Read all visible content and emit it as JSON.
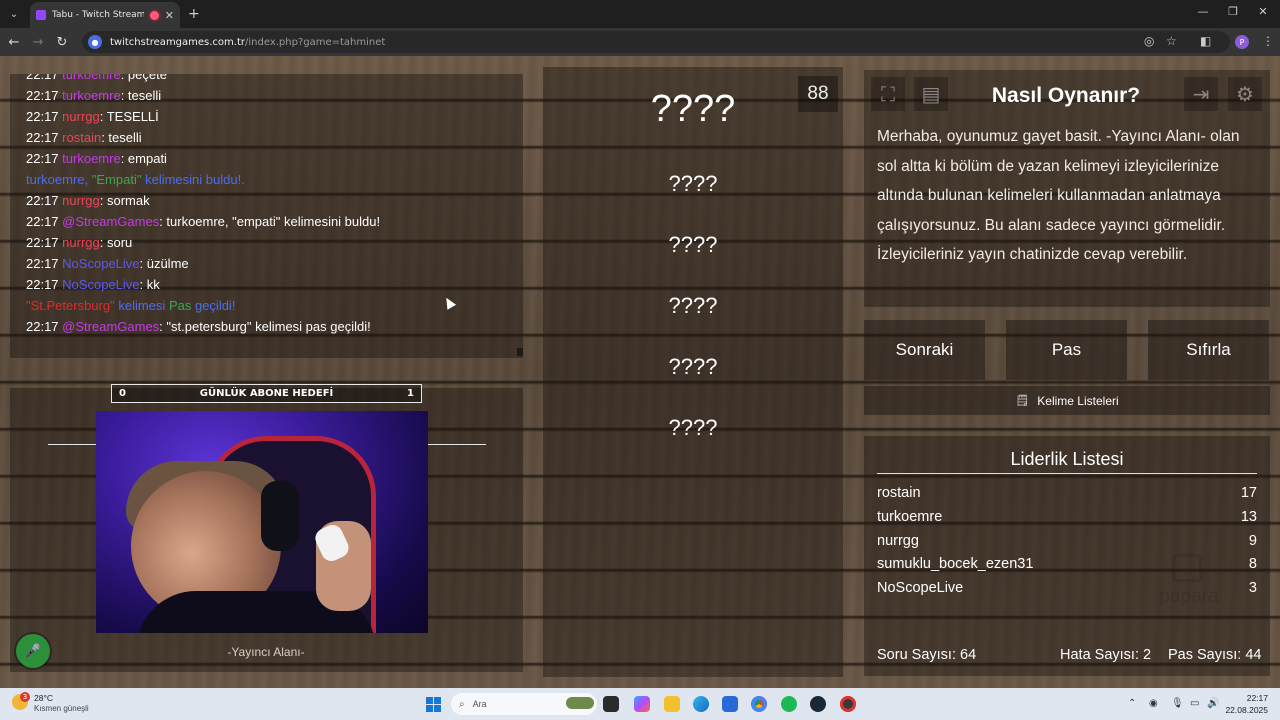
{
  "browser": {
    "tab_title": "Tabu - Twitch Stream Game",
    "url_host": "twitchstreamgames.com.tr",
    "url_path": "/index.php?game=tahminet",
    "profile_initial": "P"
  },
  "chat": {
    "lines": [
      {
        "time": "22:17",
        "user": "turkoemre",
        "text": ": peçete"
      },
      {
        "time": "22:17",
        "user": "turkoemre",
        "text": ": teselli"
      },
      {
        "time": "22:17",
        "user": "nurrgg",
        "text": ": TESELLİ"
      },
      {
        "time": "22:17",
        "user": "rostain",
        "text": ": teselli"
      },
      {
        "time": "22:17",
        "user": "turkoemre",
        "text": ": empati"
      },
      {
        "sys_user": "turkoemre,",
        "sys_word": "\"Empati\"",
        "sys_rest": "kelimesini buldu!."
      },
      {
        "time": "22:17",
        "user": "nurrgg",
        "text": ": sormak"
      },
      {
        "time": "22:17",
        "user": "@StreamGames",
        "text": ": turkoemre, \"empati\" kelimesini buldu!"
      },
      {
        "time": "22:17",
        "user": "nurrgg",
        "text": ": soru"
      },
      {
        "time": "22:17",
        "user": "NoScopeLive",
        "text": ": üzülme"
      },
      {
        "time": "22:17",
        "user": "NoScopeLive",
        "text": ": kk"
      },
      {
        "pass_word": "\"St.Petersburg\"",
        "pass_mid": "kelimesi",
        "pass_kw": "Pas",
        "pass_end": "geçildi!"
      },
      {
        "time": "22:17",
        "user": "@StreamGames",
        "text": ": \"st.petersburg\" kelimesi pas geçildi!"
      }
    ]
  },
  "streamer": {
    "goal_title": "GÜNLÜK ABONE HEDEFİ",
    "goal_current": "0",
    "goal_target": "1",
    "area_label": "-Yayıncı Alanı-",
    "mic_icon": "microphone-icon"
  },
  "words": {
    "timer": "88",
    "main": "????",
    "list": [
      "????",
      "????",
      "????",
      "????",
      "????"
    ]
  },
  "howto": {
    "title": "Nasıl Oynanır?",
    "text": "Merhaba, oyunumuz gayet basit. -Yayıncı Alanı- olan sol altta ki bölüm de yazan kelimeyi izleyicilerinize altında bulunan kelimeleri kullanmadan anlatmaya çalışıyorsunuz. Bu alanı sadece yayıncı görmelidir. İzleyicileriniz yayın chatinizde cevap verebilir."
  },
  "actions": {
    "next": "Sonraki",
    "pass": "Pas",
    "reset": "Sıfırla",
    "word_lists": "Kelime Listeleri"
  },
  "leaderboard": {
    "title": "Liderlik Listesi",
    "rows": [
      {
        "name": "rostain",
        "score": "17"
      },
      {
        "name": "turkoemre",
        "score": "13"
      },
      {
        "name": "nurrgg",
        "score": "9"
      },
      {
        "name": "sumuklu_bocek_ezen31",
        "score": "8"
      },
      {
        "name": "NoScopeLive",
        "score": "3"
      }
    ],
    "watermark": "papara"
  },
  "stats": {
    "questions": "Soru Sayısı: 64",
    "errors": "Hata Sayısı: 2",
    "passes": "Pas Sayısı: 44"
  },
  "taskbar": {
    "temp": "28°C",
    "weather": "Kısmen güneşli",
    "weather_badge": "3",
    "search_placeholder": "Ara",
    "time": "22:17",
    "date": "22.08.2025"
  },
  "colors": {
    "user_purple": "#c43ce6",
    "user_red": "#e8465a",
    "user_blue": "#5a5af0",
    "system_blue": "#4b6cf0",
    "system_green": "#3ba84a",
    "system_red": "#e02b2b",
    "mic_green": "#2c8f3a"
  }
}
